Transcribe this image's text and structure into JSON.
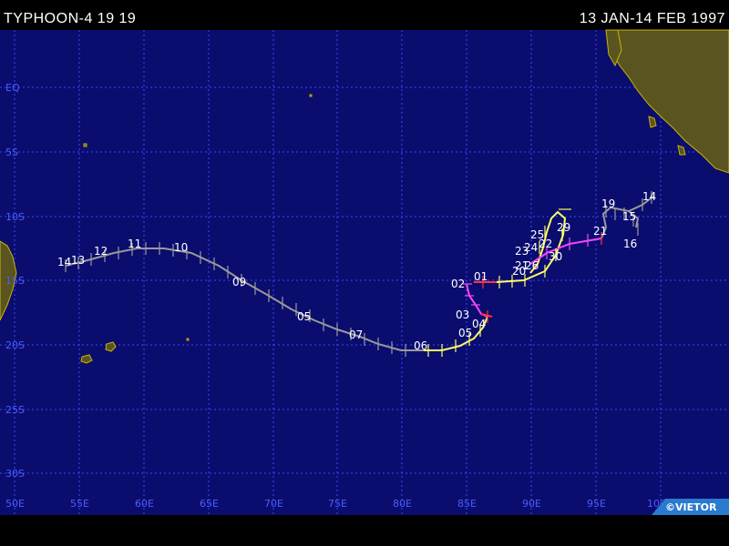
{
  "header": {
    "storm_title": "TYPHOON-4 19 19",
    "date_range": "13 JAN-14 FEB 1997"
  },
  "map": {
    "ocean_color": "#0a0d6e",
    "land_color": "#5a5520",
    "coast_color": "#c8b400",
    "grid_color": "#3a45ff",
    "lon_labels": [
      "50E",
      "55E",
      "60E",
      "65E",
      "70E",
      "75E",
      "80E",
      "85E",
      "90E",
      "95E",
      "100E"
    ],
    "lat_labels": [
      "EQ",
      "5S",
      "10S",
      "15S",
      "20S",
      "25S",
      "30S"
    ],
    "credit": "©VIETOR"
  },
  "track": {
    "colors": {
      "yellow": "#ffff66",
      "magenta": "#ff44ff",
      "red": "#ff3344",
      "gray": "#9a9a9a"
    },
    "day_labels": [
      "01",
      "02",
      "03",
      "04",
      "05",
      "06",
      "07",
      "05",
      "09",
      "10",
      "11",
      "12",
      "13",
      "14",
      "20",
      "21",
      "22",
      "23",
      "24",
      "25",
      "26",
      "29",
      "30",
      "21",
      "19",
      "15",
      "14",
      "16"
    ]
  }
}
